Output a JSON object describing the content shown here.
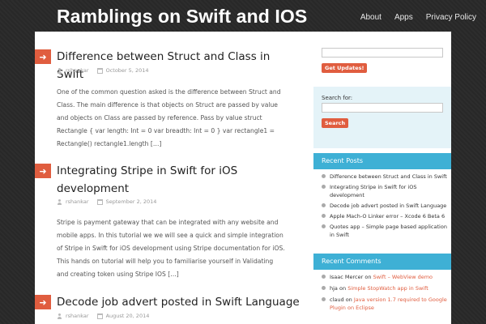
{
  "site": {
    "title": "Ramblings on Swift and IOS"
  },
  "nav": [
    {
      "label": "About"
    },
    {
      "label": "Apps"
    },
    {
      "label": "Privacy Policy"
    }
  ],
  "icons": {
    "post_marker": "arrow-right-icon",
    "author": "user-icon",
    "date": "calendar-icon",
    "bullet": "bullet-icon"
  },
  "colors": {
    "accent": "#e05d3f",
    "widget_header": "#3eb0d5",
    "search_bg": "#e4f3f8"
  },
  "posts": [
    {
      "title": "Difference between Struct and Class in Swift",
      "author": "rshankar",
      "date": "October 5, 2014",
      "excerpt": "One of the common question asked is the difference between Struct and Class. The main difference is that objects on Struct are passed by value and objects on Class are passed by reference. Pass by value struct Rectangle { var length: Int = 0 var breadth: Int = 0 } var rectangle1 = Rectangle() rectangle1.length […]"
    },
    {
      "title": "Integrating Stripe in Swift for iOS development",
      "author": "rshankar",
      "date": "September 2, 2014",
      "excerpt": "Stripe is payment gateway that can be integrated with any website and mobile apps. In this tutorial we we will see a quick and simple integration of Stripe in Swift for iOS development using Stripe documentation for iOS. This hands on tutorial will help you to familiarise yourself in Validating and creating token using Stripe IOS […]"
    },
    {
      "title": "Decode job advert posted in Swift Language",
      "author": "rshankar",
      "date": "August 20, 2014",
      "excerpt": ""
    }
  ],
  "sidebar": {
    "subscribe_button": "Get Updates!",
    "search_label": "Search for:",
    "search_button": "Search",
    "recent_posts": {
      "heading": "Recent Posts",
      "items": [
        "Difference between Struct and Class in Swift",
        "Integrating Stripe in Swift for iOS development",
        "Decode job advert posted in Swift Language",
        "Apple Mach-O Linker error – Xcode 6 Beta 6",
        "Quotes app – Simple page based application in Swift"
      ]
    },
    "recent_comments": {
      "heading": "Recent Comments",
      "items": [
        {
          "author": "Isaac Mercer",
          "on": "on",
          "post": "Swift – WebView demo"
        },
        {
          "author": "hja",
          "on": "on",
          "post": "Simple StopWatch app in Swift"
        },
        {
          "author": "claud",
          "on": "on",
          "post": "Java version 1.7 required to Google Plugin on Eclipse"
        }
      ]
    }
  }
}
